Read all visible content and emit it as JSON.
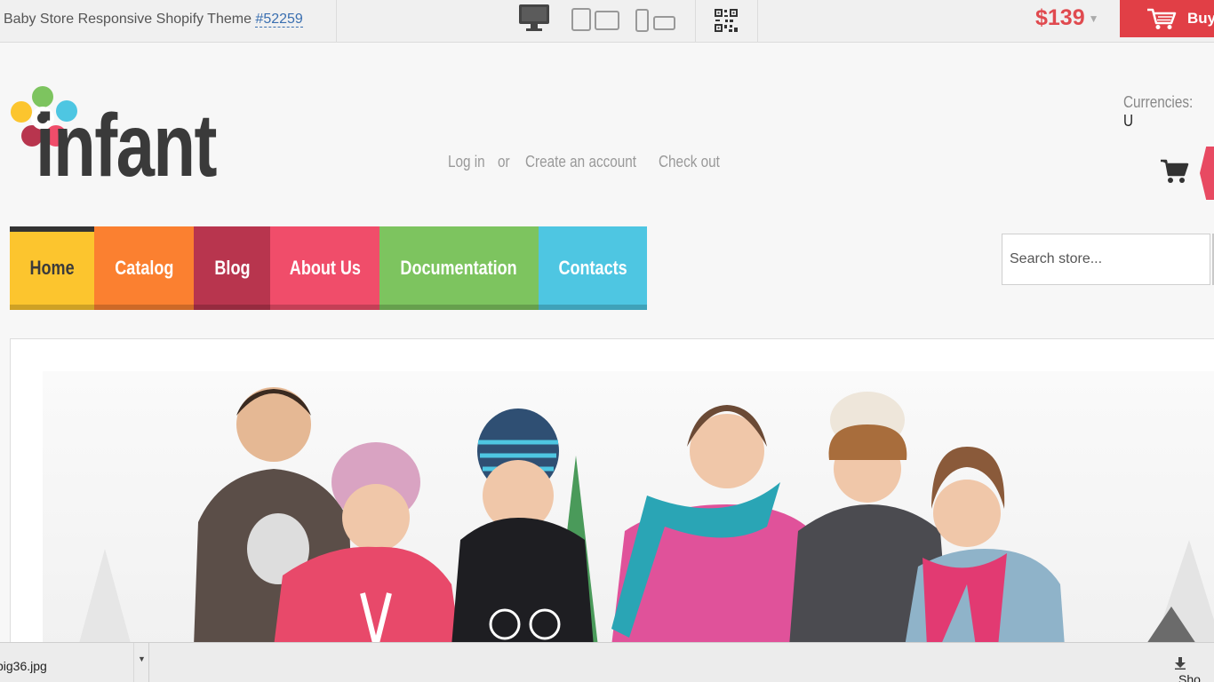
{
  "preview_bar": {
    "title": "Baby Store Responsive Shopify Theme ",
    "theme_id": "#52259",
    "devices": [
      "desktop-icon",
      "tablet-icon",
      "phone-icon",
      "qr-code-icon"
    ],
    "price": "$139",
    "buy_label": "Buy"
  },
  "header": {
    "logo_text": "infant",
    "login": "Log in",
    "or": "or",
    "create_account": "Create an account",
    "checkout": "Check out",
    "currencies_label": "Currencies:",
    "currencies_value": "U"
  },
  "nav": {
    "items": [
      {
        "label": "Home",
        "color": "#fcc52e",
        "text_color": "#3b3b3b"
      },
      {
        "label": "Catalog",
        "color": "#fb8030"
      },
      {
        "label": "Blog",
        "color": "#b8354e"
      },
      {
        "label": "About Us",
        "color": "#f04d6a"
      },
      {
        "label": "Documentation",
        "color": "#7dc45f"
      },
      {
        "label": "Contacts",
        "color": "#4ec6e2"
      }
    ],
    "active_index": 0
  },
  "search": {
    "placeholder": "Search store..."
  },
  "download_bar": {
    "file_name": "pig36.jpg",
    "show_all": "Sho"
  },
  "colors": {
    "accent_red": "#e13f46",
    "price_red": "#e04a4f",
    "link_blue": "#3a6fb0"
  }
}
